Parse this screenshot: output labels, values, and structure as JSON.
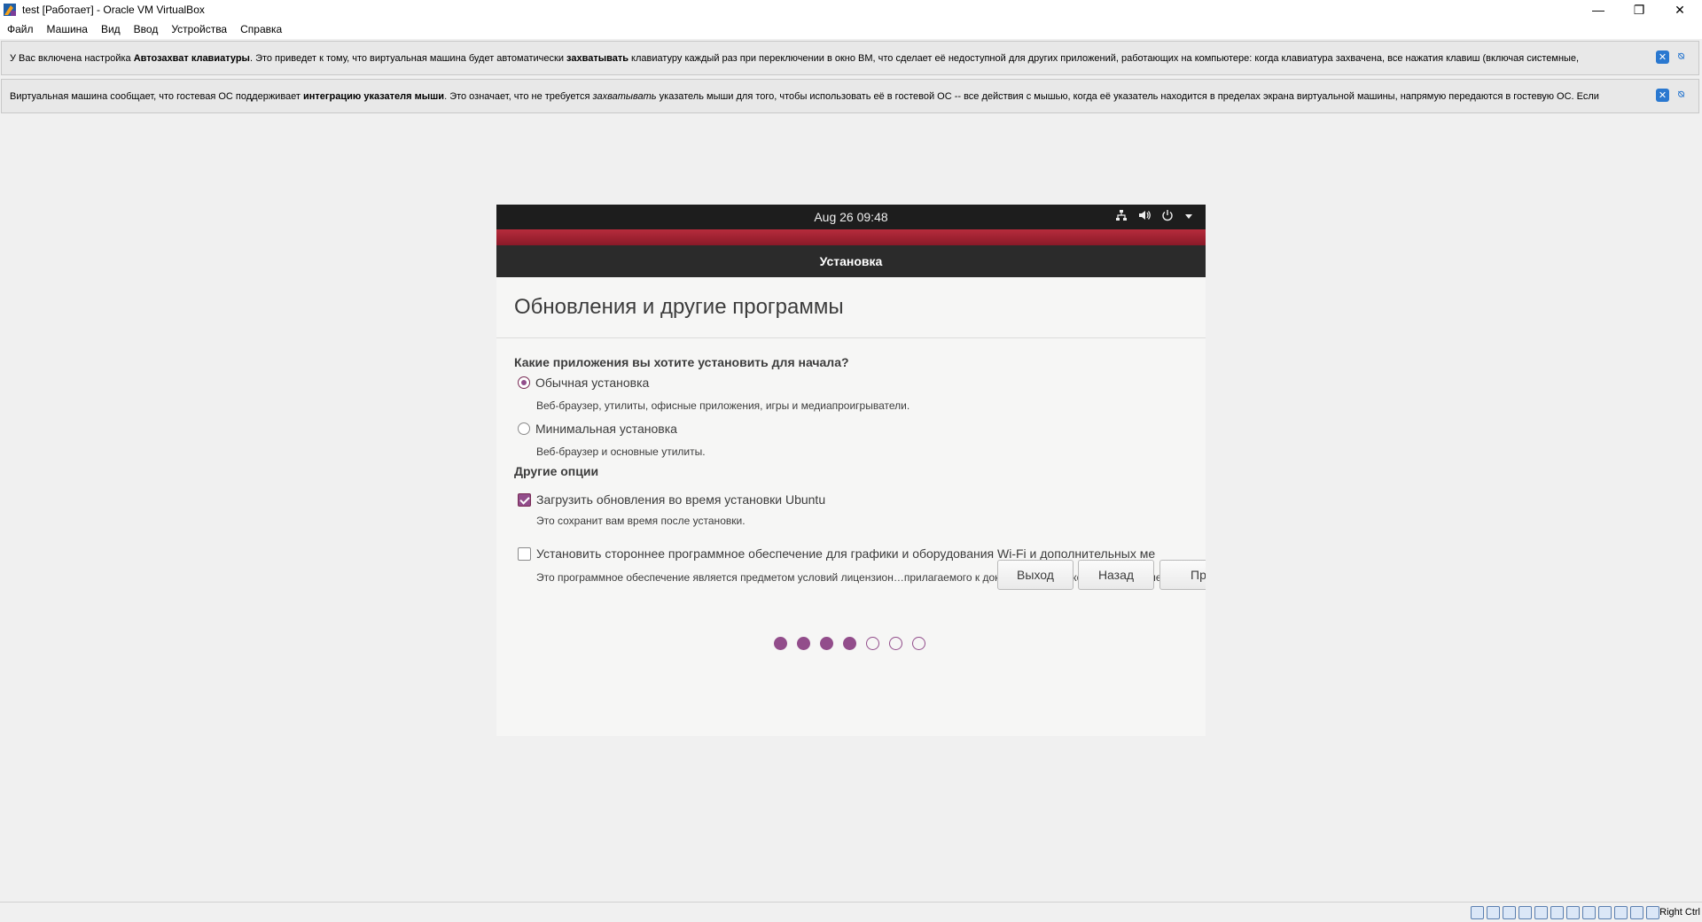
{
  "window": {
    "title": "test [Работает] - Oracle VM VirtualBox",
    "minimize": "—",
    "restore": "❐",
    "close": "✕"
  },
  "menu": [
    "Файл",
    "Машина",
    "Вид",
    "Ввод",
    "Устройства",
    "Справка"
  ],
  "notifications": {
    "keyboard": {
      "t1": "У Вас включена настройка ",
      "b1": "Автозахват клавиатуры",
      "t2": ". Это приведет к тому, что виртуальная машина будет автоматически ",
      "b2": "захватывать",
      "t3": " клавиатуру каждый раз при переключении в окно ВМ, что сделает её недоступной для других приложений, работающих на компьютере: когда клавиатура захвачена, все нажатия клавиш (включая системные,"
    },
    "mouse": {
      "t1": "Виртуальная машина сообщает, что гостевая ОС поддерживает ",
      "b1": "интеграцию указателя мыши",
      "t2": ". Это означает, что не требуется ",
      "i1": "захватывать",
      "t3": " указатель мыши для того, чтобы использовать её в гостевой ОС -- все действия с мышью, когда её указатель находится в пределах экрана виртуальной машины, напрямую передаются в гостевую ОС. Если"
    }
  },
  "vm": {
    "clock": "Aug 26  09:48",
    "dialog_title": "Установка",
    "page_title": "Обновления и другие программы",
    "question": "Какие приложения вы хотите установить для начала?",
    "normal_install": "Обычная установка",
    "normal_desc": "Веб-браузер, утилиты, офисные приложения, игры и медиапроигрыватели.",
    "minimal_install": "Минимальная установка",
    "minimal_desc": "Веб-браузер и основные утилиты.",
    "other_options": "Другие опции",
    "download_updates": "Загрузить обновления во время установки Ubuntu",
    "download_desc": "Это сохранит вам время после установки.",
    "third_party": "Установить стороннее программное обеспечение для графики и оборудования Wi-Fi и дополнительных ме",
    "third_party_desc": "Это программное обеспечение является предметом условий лицензион…прилагаемого к документации. Некоторое ПО является",
    "btn_quit": "Выход",
    "btn_back": "Назад",
    "btn_next": "Пр",
    "steps_total": 7,
    "steps_done": 4
  },
  "statusbar": {
    "hostkey": "Right Ctrl"
  }
}
